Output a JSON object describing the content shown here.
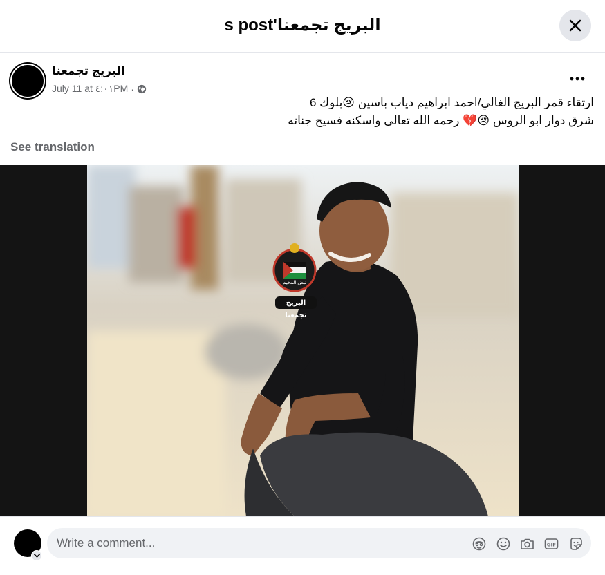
{
  "header": {
    "title": "البريج تجمعنا's post"
  },
  "post": {
    "author": "البريج تجمعنا",
    "timestamp": "July 11 at ٤:٠١PM",
    "separator": "·",
    "text_line1": "ارتقاء قمر البريج الغالي/احمد ابراهيم دياب باسين 😢بلوك 6",
    "text_line2": "شرق دوار ابو الروس 😢💔 رحمه الله تعالى واسكنه فسيح جناته",
    "see_translation": "See translation",
    "watermark_text": "البريج تجمعنا",
    "watermark_sub": "نبض المخيم"
  },
  "comment": {
    "placeholder": "Write a comment..."
  },
  "icons": {
    "close": "close-icon",
    "more": "more-horizontal-icon",
    "audience": "globe-icon",
    "avatar_menu": "chevron-down-icon",
    "comment_tools": [
      "avatar-sticker-icon",
      "emoji-icon",
      "camera-icon",
      "gif-icon",
      "sticker-icon"
    ]
  },
  "colors": {
    "secondary_text": "#65676b",
    "chip_bg": "#e4e6eb",
    "input_bg": "#f0f2f5",
    "media_bg": "#141414"
  }
}
